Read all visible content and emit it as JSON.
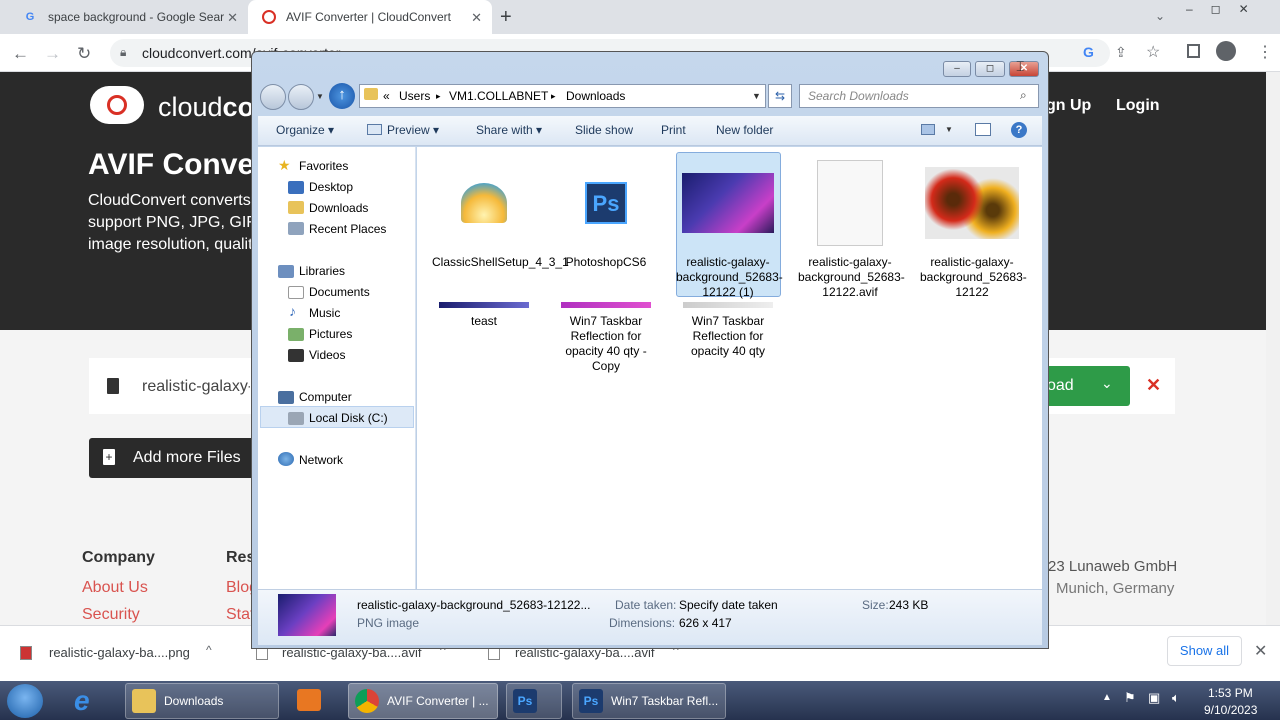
{
  "browser": {
    "tabs": [
      {
        "label": "space background - Google Sear"
      },
      {
        "label": "AVIF Converter | CloudConvert"
      }
    ],
    "new_tab_symbol": "+",
    "url": "cloudconvert.com/avif-converter"
  },
  "page": {
    "logo_text_light": "cloud",
    "logo_text_bold": "co",
    "signup": "gn Up",
    "login": "Login",
    "heading": "AVIF Converter",
    "desc_lines": [
      "CloudConvert converts",
      "support PNG, JPG, GIF, W",
      "image resolution, quality"
    ],
    "file_name": "realistic-galaxy-background",
    "download_label": "oad",
    "add_files": "Add more Files",
    "footer": {
      "company_heading": "Company",
      "resources_heading": "Res",
      "company_links": [
        "About Us",
        "Security"
      ],
      "resources_links": [
        "Blog",
        "Stat"
      ],
      "copyright_line1": "23 Lunaweb GmbH",
      "copyright_line2": "Munich, Germany"
    }
  },
  "explorer": {
    "breadcrumb": [
      "«",
      "Users",
      "VM1.COLLABNET",
      "Downloads"
    ],
    "search_placeholder": "Search Downloads",
    "toolbar": [
      "Organize",
      "Preview",
      "Share with",
      "Slide show",
      "Print",
      "New folder"
    ],
    "nav": {
      "favorites": "Favorites",
      "favorites_items": [
        "Desktop",
        "Downloads",
        "Recent Places"
      ],
      "libraries": "Libraries",
      "libraries_items": [
        "Documents",
        "Music",
        "Pictures",
        "Videos"
      ],
      "computer": "Computer",
      "local_disk": "Local Disk (C:)",
      "network": "Network"
    },
    "files": [
      {
        "name": "ClassicShellSetup_4_3_1"
      },
      {
        "name": "PhotoshopCS6"
      },
      {
        "name": "realistic-galaxy-background_52683-12122 (1)"
      },
      {
        "name": "realistic-galaxy-background_52683-12122.avif"
      },
      {
        "name": "realistic-galaxy-background_52683-12122"
      },
      {
        "name": "teast"
      },
      {
        "name": "Win7 Taskbar Reflection for opacity 40 qty - Copy"
      },
      {
        "name": "Win7 Taskbar Reflection for opacity 40 qty"
      }
    ],
    "details": {
      "filename": "realistic-galaxy-background_52683-12122...",
      "type": "PNG image",
      "date_label": "Date taken:",
      "date_value": "Specify date taken",
      "dim_label": "Dimensions:",
      "dim_value": "626 x 417",
      "size_label": "Size:",
      "size_value": "243 KB"
    },
    "ps_glyph": "Ps"
  },
  "downloads": {
    "items": [
      "realistic-galaxy-ba....png",
      "realistic-galaxy-ba....avif",
      "realistic-galaxy-ba....avif"
    ],
    "show_all": "Show all"
  },
  "taskbar": {
    "buttons": [
      "Downloads",
      "AVIF Converter | ...",
      "Win7 Taskbar Refl..."
    ],
    "time": "1:53 PM",
    "date": "9/10/2023"
  },
  "colors": {
    "accent_red": "#d93025",
    "cc_green": "#2e9b48",
    "link_red": "#d9534f"
  }
}
